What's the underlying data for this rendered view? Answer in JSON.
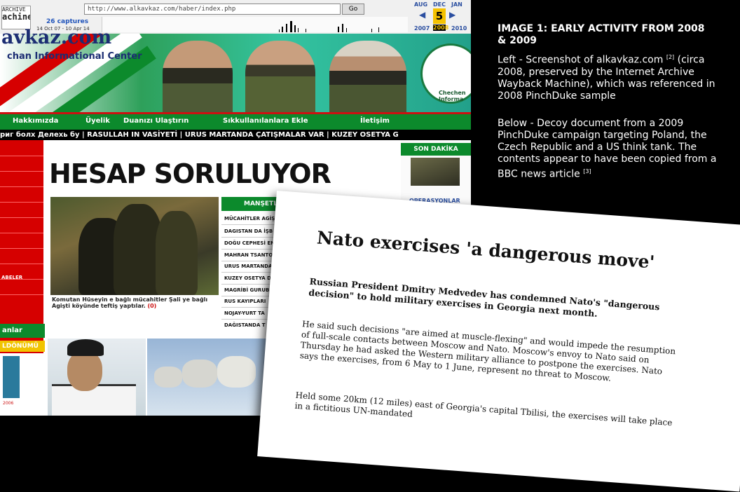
{
  "wayback": {
    "logo_line1": "ARCHIVE",
    "logo_line2": "achine",
    "url": "http://www.alkavkaz.com/haber/index.php",
    "go_label": "Go",
    "captures": "26 captures",
    "range": "14 Oct 07 - 10 Apr 14",
    "months": [
      "AUG",
      "DEC",
      "JAN"
    ],
    "years": [
      "2007",
      "2008",
      "2010"
    ],
    "day": "5"
  },
  "site": {
    "name": "avkaz.com",
    "subtitle": "chan Informational Center",
    "emblem_text": "Chechen Informa",
    "nav": [
      "Hakkımızda",
      "Üyelik",
      "Duanızı Ulaştırın",
      "Sıkkullanılanlara Ekle",
      "İletişim"
    ],
    "ticker": "риг болх Делехь бу | RASULLAH IN VASİYETİ | URUS MARTANDA ÇATIŞMALAR VAR | KUZEY OSETYA G",
    "headline": "HESAP SORULUYOR",
    "photo_caption": "Komutan Hüseyin e bağlı mücahitler Şali ye bağlı Agişti köyünde teftiş yaptılar.",
    "photo_caption_count": "(0)",
    "manset_title": "MANŞETLE",
    "manset_items": [
      "MÜCAHİTLER AGİŞ",
      "DAGISTAN DA İŞB",
      "DOĞU CEPHESİ EN",
      "MAHRAN TSANTO",
      "URUS MARTANDA",
      "KUZEY OSETYA D",
      "MAGRİBİ GURUB",
      "RUS KAYIPLARI",
      "NOJAY-YURT TA",
      "DAĞISTANDA T"
    ],
    "son_dakika": "SON DAKİKA",
    "operasyon": "OPERASYONLAR",
    "left_label": "ABELER",
    "left_anlar": "anlar",
    "left_donum": "LDÖNÜMÜ",
    "left_year": "2006"
  },
  "annotation": {
    "title": "IMAGE 1: EARLY ACTIVITY FROM 2008 & 2009",
    "para1": "Left - Screenshot of alkavkaz.com",
    "para1_ref": "[2]",
    "para1_rest": "(circa 2008, preserved by the Internet Archive Wayback Machine), which was referenced in 2008 PinchDuke sample",
    "para2": "Below - Decoy document from a 2009 PinchDuke campaign targeting Poland, the Czech Republic and a US think tank. The contents appear to have been copied from a BBC news article",
    "para2_ref": "[3]"
  },
  "decoy": {
    "headline": "Nato exercises 'a dangerous move'",
    "lead": "Russian President Dmitry Medvedev has condemned Nato's \"dangerous decision\" to hold military exercises in Georgia next month.",
    "p1": "He said such decisions \"are aimed at muscle-flexing\" and would impede the resumption of full-scale contacts between Moscow and Nato. Moscow's envoy to Nato said on Thursday he had asked the Western military alliance to postpone the exercises. Nato says the exercises, from 6 May to 1 June, represent no threat to Moscow.",
    "p2": "Held some 20km (12 miles) east of Georgia's capital Tbilisi, the exercises will take place in a fictitious UN-mandated"
  },
  "colors": {
    "accent_green": "#0c8a2c",
    "site_red": "#d60000",
    "wayback_blue": "#2a4ea0",
    "wayback_yellow": "#f5c200"
  }
}
